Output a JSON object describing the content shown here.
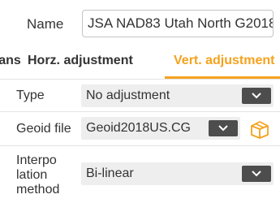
{
  "name_row": {
    "label": "Name",
    "value": "JSA NAD83 Utah North G2018"
  },
  "tabs": [
    {
      "label": "rans",
      "active": false
    },
    {
      "label": "Horz. adjustment",
      "active": false
    },
    {
      "label": "Vert. adjustment",
      "active": true
    }
  ],
  "type_row": {
    "label": "Type",
    "value": "No adjustment"
  },
  "geoid_row": {
    "label": "Geoid file",
    "value": "Geoid2018US.CG"
  },
  "interp_row": {
    "label_lines": [
      "Interpo",
      "lation",
      "method"
    ],
    "value": "Bi-linear"
  },
  "colors": {
    "accent": "#f5a21d",
    "dropdown_button": "#4d4d4d",
    "select_bg": "#eeeeee",
    "text": "#333333"
  },
  "icons": {
    "dropdown": "chevron-down-icon",
    "geoid_action": "package-box-icon"
  }
}
